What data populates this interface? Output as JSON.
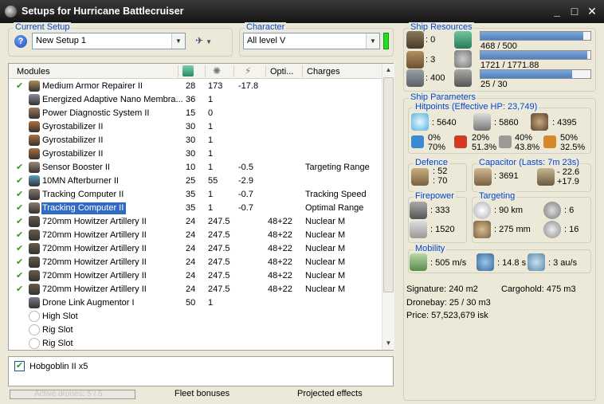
{
  "window": {
    "title": "Setups for Hurricane Battlecruiser",
    "controls": {
      "minimize": "_",
      "maximize": "□",
      "close": "✕"
    }
  },
  "current_setup": {
    "label": "Current Setup",
    "value": "New Setup 1"
  },
  "character": {
    "label": "Character",
    "value": "All level V",
    "status_color": "#22dd22"
  },
  "modules": {
    "headers": {
      "name": "Modules",
      "col_opti": "Opti...",
      "col_charges": "Charges"
    },
    "rows": [
      {
        "checked": true,
        "name": "Medium Armor Repairer II",
        "cpu": "28",
        "pg": "173",
        "mod": "-17.8",
        "opti": "",
        "charges": "",
        "icon_color": "#b08a5a"
      },
      {
        "checked": false,
        "name": "Energized Adaptive Nano Membra...",
        "cpu": "36",
        "pg": "1",
        "mod": "",
        "opti": "",
        "charges": "",
        "icon_color": "#8a8a9a"
      },
      {
        "checked": false,
        "name": "Power Diagnostic System II",
        "cpu": "15",
        "pg": "0",
        "mod": "",
        "opti": "",
        "charges": "",
        "icon_color": "#a07a5a"
      },
      {
        "checked": false,
        "name": "Gyrostabilizer II",
        "cpu": "30",
        "pg": "1",
        "mod": "",
        "opti": "",
        "charges": "",
        "icon_color": "#b07040"
      },
      {
        "checked": false,
        "name": "Gyrostabilizer II",
        "cpu": "30",
        "pg": "1",
        "mod": "",
        "opti": "",
        "charges": "",
        "icon_color": "#b07040"
      },
      {
        "checked": false,
        "name": "Gyrostabilizer II",
        "cpu": "30",
        "pg": "1",
        "mod": "",
        "opti": "",
        "charges": "",
        "icon_color": "#b07040"
      },
      {
        "checked": true,
        "name": "Sensor Booster II",
        "cpu": "10",
        "pg": "1",
        "mod": "-0.5",
        "opti": "",
        "charges": "Targeting Range",
        "icon_color": "#9a8a7a"
      },
      {
        "checked": true,
        "name": "10MN Afterburner II",
        "cpu": "25",
        "pg": "55",
        "mod": "-2.9",
        "opti": "",
        "charges": "",
        "icon_color": "#5aa0c0"
      },
      {
        "checked": true,
        "name": "Tracking Computer II",
        "cpu": "35",
        "pg": "1",
        "mod": "-0.7",
        "opti": "",
        "charges": "Tracking Speed",
        "icon_color": "#8a7a6a"
      },
      {
        "checked": true,
        "name": "Tracking Computer II",
        "cpu": "35",
        "pg": "1",
        "mod": "-0.7",
        "opti": "",
        "charges": "Optimal Range",
        "icon_color": "#8a7a6a",
        "selected": true
      },
      {
        "checked": true,
        "name": "720mm Howitzer Artillery II",
        "cpu": "24",
        "pg": "247.5",
        "mod": "",
        "opti": "48+22",
        "charges": "Nuclear M",
        "icon_color": "#6a5a4a"
      },
      {
        "checked": true,
        "name": "720mm Howitzer Artillery II",
        "cpu": "24",
        "pg": "247.5",
        "mod": "",
        "opti": "48+22",
        "charges": "Nuclear M",
        "icon_color": "#6a5a4a"
      },
      {
        "checked": true,
        "name": "720mm Howitzer Artillery II",
        "cpu": "24",
        "pg": "247.5",
        "mod": "",
        "opti": "48+22",
        "charges": "Nuclear M",
        "icon_color": "#6a5a4a"
      },
      {
        "checked": true,
        "name": "720mm Howitzer Artillery II",
        "cpu": "24",
        "pg": "247.5",
        "mod": "",
        "opti": "48+22",
        "charges": "Nuclear M",
        "icon_color": "#6a5a4a"
      },
      {
        "checked": true,
        "name": "720mm Howitzer Artillery II",
        "cpu": "24",
        "pg": "247.5",
        "mod": "",
        "opti": "48+22",
        "charges": "Nuclear M",
        "icon_color": "#6a5a4a"
      },
      {
        "checked": true,
        "name": "720mm Howitzer Artillery II",
        "cpu": "24",
        "pg": "247.5",
        "mod": "",
        "opti": "48+22",
        "charges": "Nuclear M",
        "icon_color": "#6a5a4a"
      },
      {
        "checked": false,
        "name": "Drone Link Augmentor I",
        "cpu": "50",
        "pg": "1",
        "mod": "",
        "opti": "",
        "charges": "",
        "icon_color": "#7a7a8a"
      },
      {
        "checked": false,
        "name": "High Slot",
        "cpu": "",
        "pg": "",
        "mod": "",
        "opti": "",
        "charges": "",
        "icon_color": "#dddddd"
      },
      {
        "checked": false,
        "name": "Rig Slot",
        "cpu": "",
        "pg": "",
        "mod": "",
        "opti": "",
        "charges": "",
        "icon_color": "#dddddd"
      },
      {
        "checked": false,
        "name": "Rig Slot",
        "cpu": "",
        "pg": "",
        "mod": "",
        "opti": "",
        "charges": "",
        "icon_color": "#dddddd"
      }
    ]
  },
  "drones": {
    "items": [
      {
        "checked": true,
        "name": "Hobgoblin II x5"
      }
    ]
  },
  "bottom": {
    "active_drones": "Active drones: 5 / 5",
    "fleet_bonuses": "Fleet bonuses",
    "projected_effects": "Projected effects"
  },
  "ship_resources": {
    "label": "Ship Resources",
    "turret": ": 0",
    "launcher": ": 3",
    "drone_bw": ": 400",
    "cpu": {
      "text": "468 / 500",
      "fraction": 0.936
    },
    "powergrid": {
      "text": "1721 / 1771.88",
      "fraction": 0.971
    },
    "calibration": {
      "text": "25 / 30",
      "fraction": 0.833
    }
  },
  "ship_parameters": {
    "label": "Ship Parameters",
    "hitpoints": {
      "label": "Hitpoints (Effective HP: 23,749)",
      "shield": ": 5640",
      "armor": ": 5860",
      "structure": ": 4395",
      "res_em": "0%",
      "res_em2": "70%",
      "res_therm": "20%",
      "res_therm2": "51.3%",
      "res_kin": "40%",
      "res_kin2": "43.8%",
      "res_exp": "50%",
      "res_exp2": "32.5%"
    },
    "defence": {
      "label": "Defence",
      "v1": ": 52",
      "v2": ": 70"
    },
    "capacitor": {
      "label": "Capacitor (Lasts: 7m 23s)",
      "amount": ": 3691",
      "delta1": "- 22.6",
      "delta2": "+17.9"
    },
    "firepower": {
      "label": "Firepower",
      "dps": ": 333",
      "volley": ": 1520"
    },
    "targeting": {
      "label": "Targeting",
      "range": ": 90 km",
      "targets": ": 6",
      "scan_res": ": 275 mm",
      "sensor": ": 16"
    },
    "mobility": {
      "label": "Mobility",
      "speed": ": 505 m/s",
      "align": ": 14.8 s",
      "warp": ": 3 au/s"
    },
    "signature": "Signature: 240 m2",
    "cargohold": "Cargohold: 475 m3",
    "dronebay": "Dronebay: 25 / 30 m3",
    "price": "Price: 57,523,679 isk"
  }
}
